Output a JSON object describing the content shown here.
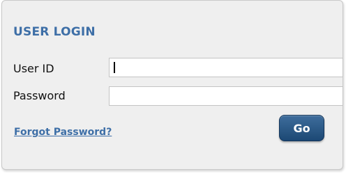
{
  "login": {
    "title": "USER LOGIN",
    "user_id_label": "User ID",
    "password_label": "Password",
    "user_id_value": "",
    "password_value": "",
    "forgot_password": "Forgot Password?",
    "go_button": "Go"
  },
  "colors": {
    "accent": "#3e6fa7",
    "button": "#1c4874",
    "panel_bg": "#efefef"
  }
}
